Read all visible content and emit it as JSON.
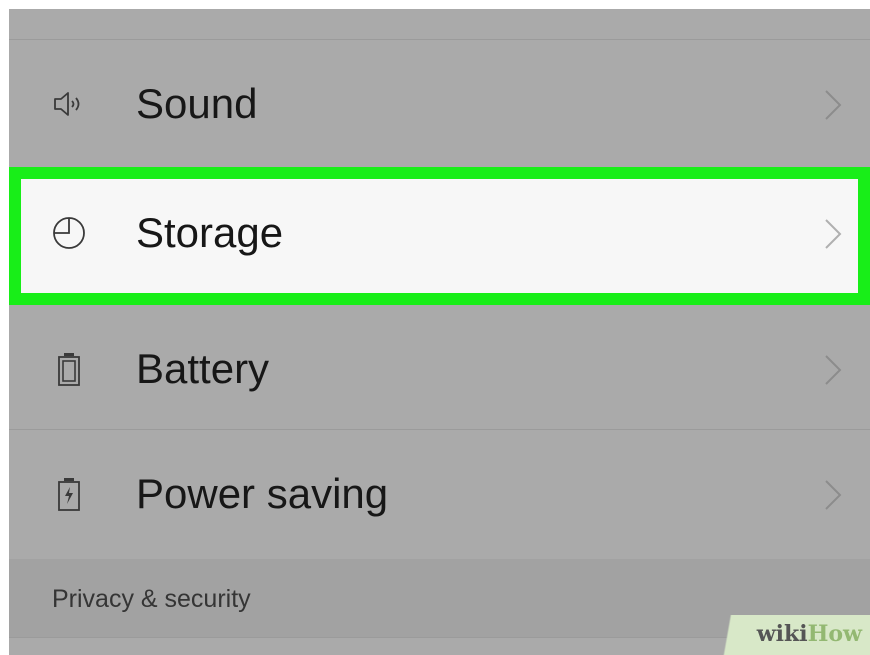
{
  "settings": {
    "items": [
      {
        "label": "Sound",
        "icon": "speaker-icon",
        "selected": false
      },
      {
        "label": "Storage",
        "icon": "storage-pie-icon",
        "selected": true
      },
      {
        "label": "Battery",
        "icon": "battery-icon",
        "selected": false
      },
      {
        "label": "Power saving",
        "icon": "power-saving-battery-icon",
        "selected": false
      }
    ],
    "section_header": "Privacy & security"
  },
  "highlight_color": "#18ee18",
  "watermark": {
    "wiki": "wiki",
    "how": "How"
  }
}
